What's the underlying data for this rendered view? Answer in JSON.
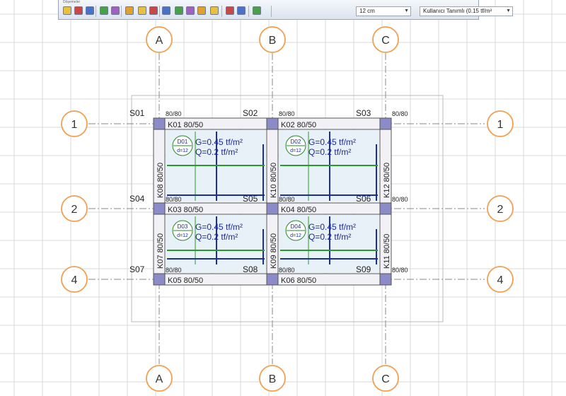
{
  "toolbar": {
    "title": "Döşemeler",
    "thickness_value": "12 cm",
    "load_type_value": "Kullanıcı Tanımlı (0.15 tf/m²",
    "icons": [
      "slab-icon",
      "slab-wizard-icon",
      "slab-copy-icon",
      "beam-icon",
      "beam-edit-icon",
      "table-icon",
      "ribbed-slab-icon",
      "grid-icon",
      "column-icon",
      "wall-icon",
      "area-icon",
      "mesh-icon",
      "edit-icon",
      "foundation-icon",
      "footing-icon",
      "stair-icon",
      "palette-icon"
    ]
  },
  "axes": {
    "columns": [
      "A",
      "B",
      "C"
    ],
    "rows": [
      "1",
      "2",
      "4"
    ]
  },
  "columns_labels": [
    "S01",
    "S02",
    "S03",
    "S04",
    "S05",
    "S06",
    "S07",
    "S08",
    "S09"
  ],
  "column_sizes": [
    "80/80",
    "80/80",
    "80/80",
    "80/80",
    "80/80",
    "80/80",
    "80/80",
    "80/80",
    "80/80"
  ],
  "beams": {
    "h": [
      "K01 80/50",
      "K02 80/50",
      "K03 80/50",
      "K04 80/50",
      "K05 80/50",
      "K06 80/50"
    ],
    "v": [
      "K08 80/50",
      "K10 80/50",
      "K12 80/50",
      "K07 80/50",
      "K09 80/50",
      "K11 80/50"
    ]
  },
  "slabs": [
    {
      "id": "D01",
      "d": "d=12",
      "g": "G=0.45 tf/m²",
      "q": "Q=0.2 tf/m²"
    },
    {
      "id": "D02",
      "d": "d=12",
      "g": "G=0.45 tf/m²",
      "q": "Q=0.2 tf/m²"
    },
    {
      "id": "D03",
      "d": "d=12",
      "g": "G=0.45 tf/m²",
      "q": "Q=0.2 tf/m²"
    },
    {
      "id": "D04",
      "d": "d=12",
      "g": "G=0.45 tf/m²",
      "q": "Q=0.2 tf/m²"
    }
  ],
  "colors": {
    "grid": "#d9d9d9",
    "axis_circle": "#f0a050",
    "column_fill": "#8b8bc8",
    "beam_line": "#555555",
    "slab_fill": "#e8f0f8",
    "rebar_blue": "#1a2f9c",
    "rebar_green": "#2a9a2a",
    "text_blue": "#1a2a9c"
  }
}
